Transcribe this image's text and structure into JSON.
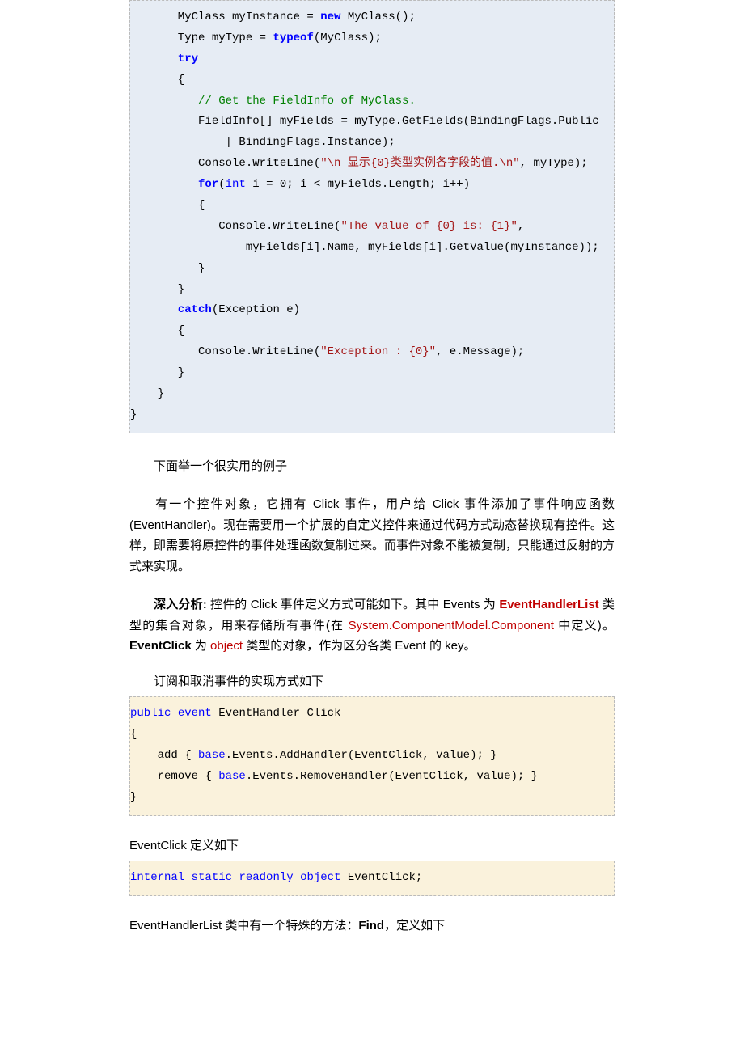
{
  "code1": {
    "l1a": "       MyClass myInstance = ",
    "l1kw": "new",
    "l1b": " MyClass();",
    "l2a": "       Type myType = ",
    "l2kw": "typeof",
    "l2b": "(MyClass);",
    "l3kw": "       try",
    "l4": "       {",
    "l5c": "          // Get the FieldInfo of MyClass.",
    "l6": "          FieldInfo[] myFields = myType.GetFields(BindingFlags.Public",
    "l7": "              | BindingFlags.Instance);",
    "l8a": "          Console.WriteLine(",
    "l8s": "\"\\n 显示{0}类型实例各字段的值.\\n\"",
    "l8b": ", myType);",
    "l9a": "          ",
    "l9kw": "for",
    "l9b": "(",
    "l9kw2": "int",
    "l9c": " i = 0; i < myFields.Length; i++)",
    "l10": "          {",
    "l11a": "             Console.WriteLine(",
    "l11s": "\"The value of {0} is: {1}\"",
    "l11b": ",",
    "l12": "                 myFields[i].Name, myFields[i].GetValue(myInstance));",
    "l13": "          }",
    "l14": "       }",
    "l15a": "       ",
    "l15kw": "catch",
    "l15b": "(Exception e)",
    "l16": "       {",
    "l17a": "          Console.WriteLine(",
    "l17s": "\"Exception : {0}\"",
    "l17b": ", e.Message);",
    "l18": "       }",
    "l19": "    }",
    "l20": "}"
  },
  "p1": "下面举一个很实用的例子",
  "p2": {
    "a": "有一个控件对象，它拥有 Click 事件，用户给 Click 事件添加了事件响应函数 (EventHandler)。现在需要用一个扩展的自定义控件来通过代码方式动态替换现有控件。这样，即需要将原控件的事件处理函数复制过来。而事件对象不能被复制，只能通过反射的方式来实现。"
  },
  "p3": {
    "label": "深入分析: ",
    "a": "控件的 Click 事件定义方式可能如下。其中 Events 为 ",
    "r1": "EventHandlerList",
    "b": " 类型的集合对象，用来存储所有事件(在 ",
    "r2": "System.ComponentModel.Component",
    "c": " 中定义)。",
    "bold2": "EventClick",
    "d": " 为 ",
    "r3": "object",
    "e": " 类型的对象，作为区分各类 Event 的 key。"
  },
  "p4": "订阅和取消事件的实现方式如下",
  "code2": {
    "l1a": "public",
    "l1b": " ",
    "l1c": "event",
    "l1d": " EventHandler Click",
    "l2": "{",
    "l3a": "    add { ",
    "l3b": "base",
    "l3c": ".Events.AddHandler(EventClick, value); }",
    "l4a": "    remove { ",
    "l4b": "base",
    "l4c": ".Events.RemoveHandler(EventClick, value); }",
    "l5": "}"
  },
  "p5": "  EventClick 定义如下",
  "code3": {
    "l1a": "internal",
    "l1b": " ",
    "l1c": "static",
    "l1d": " ",
    "l1e": "readonly",
    "l1f": " ",
    "l1g": "object",
    "l1h": " EventClick;"
  },
  "p6": {
    "a": "  EventHandlerList 类中有一个特殊的方法：",
    "b": "Find",
    "c": "，定义如下"
  }
}
